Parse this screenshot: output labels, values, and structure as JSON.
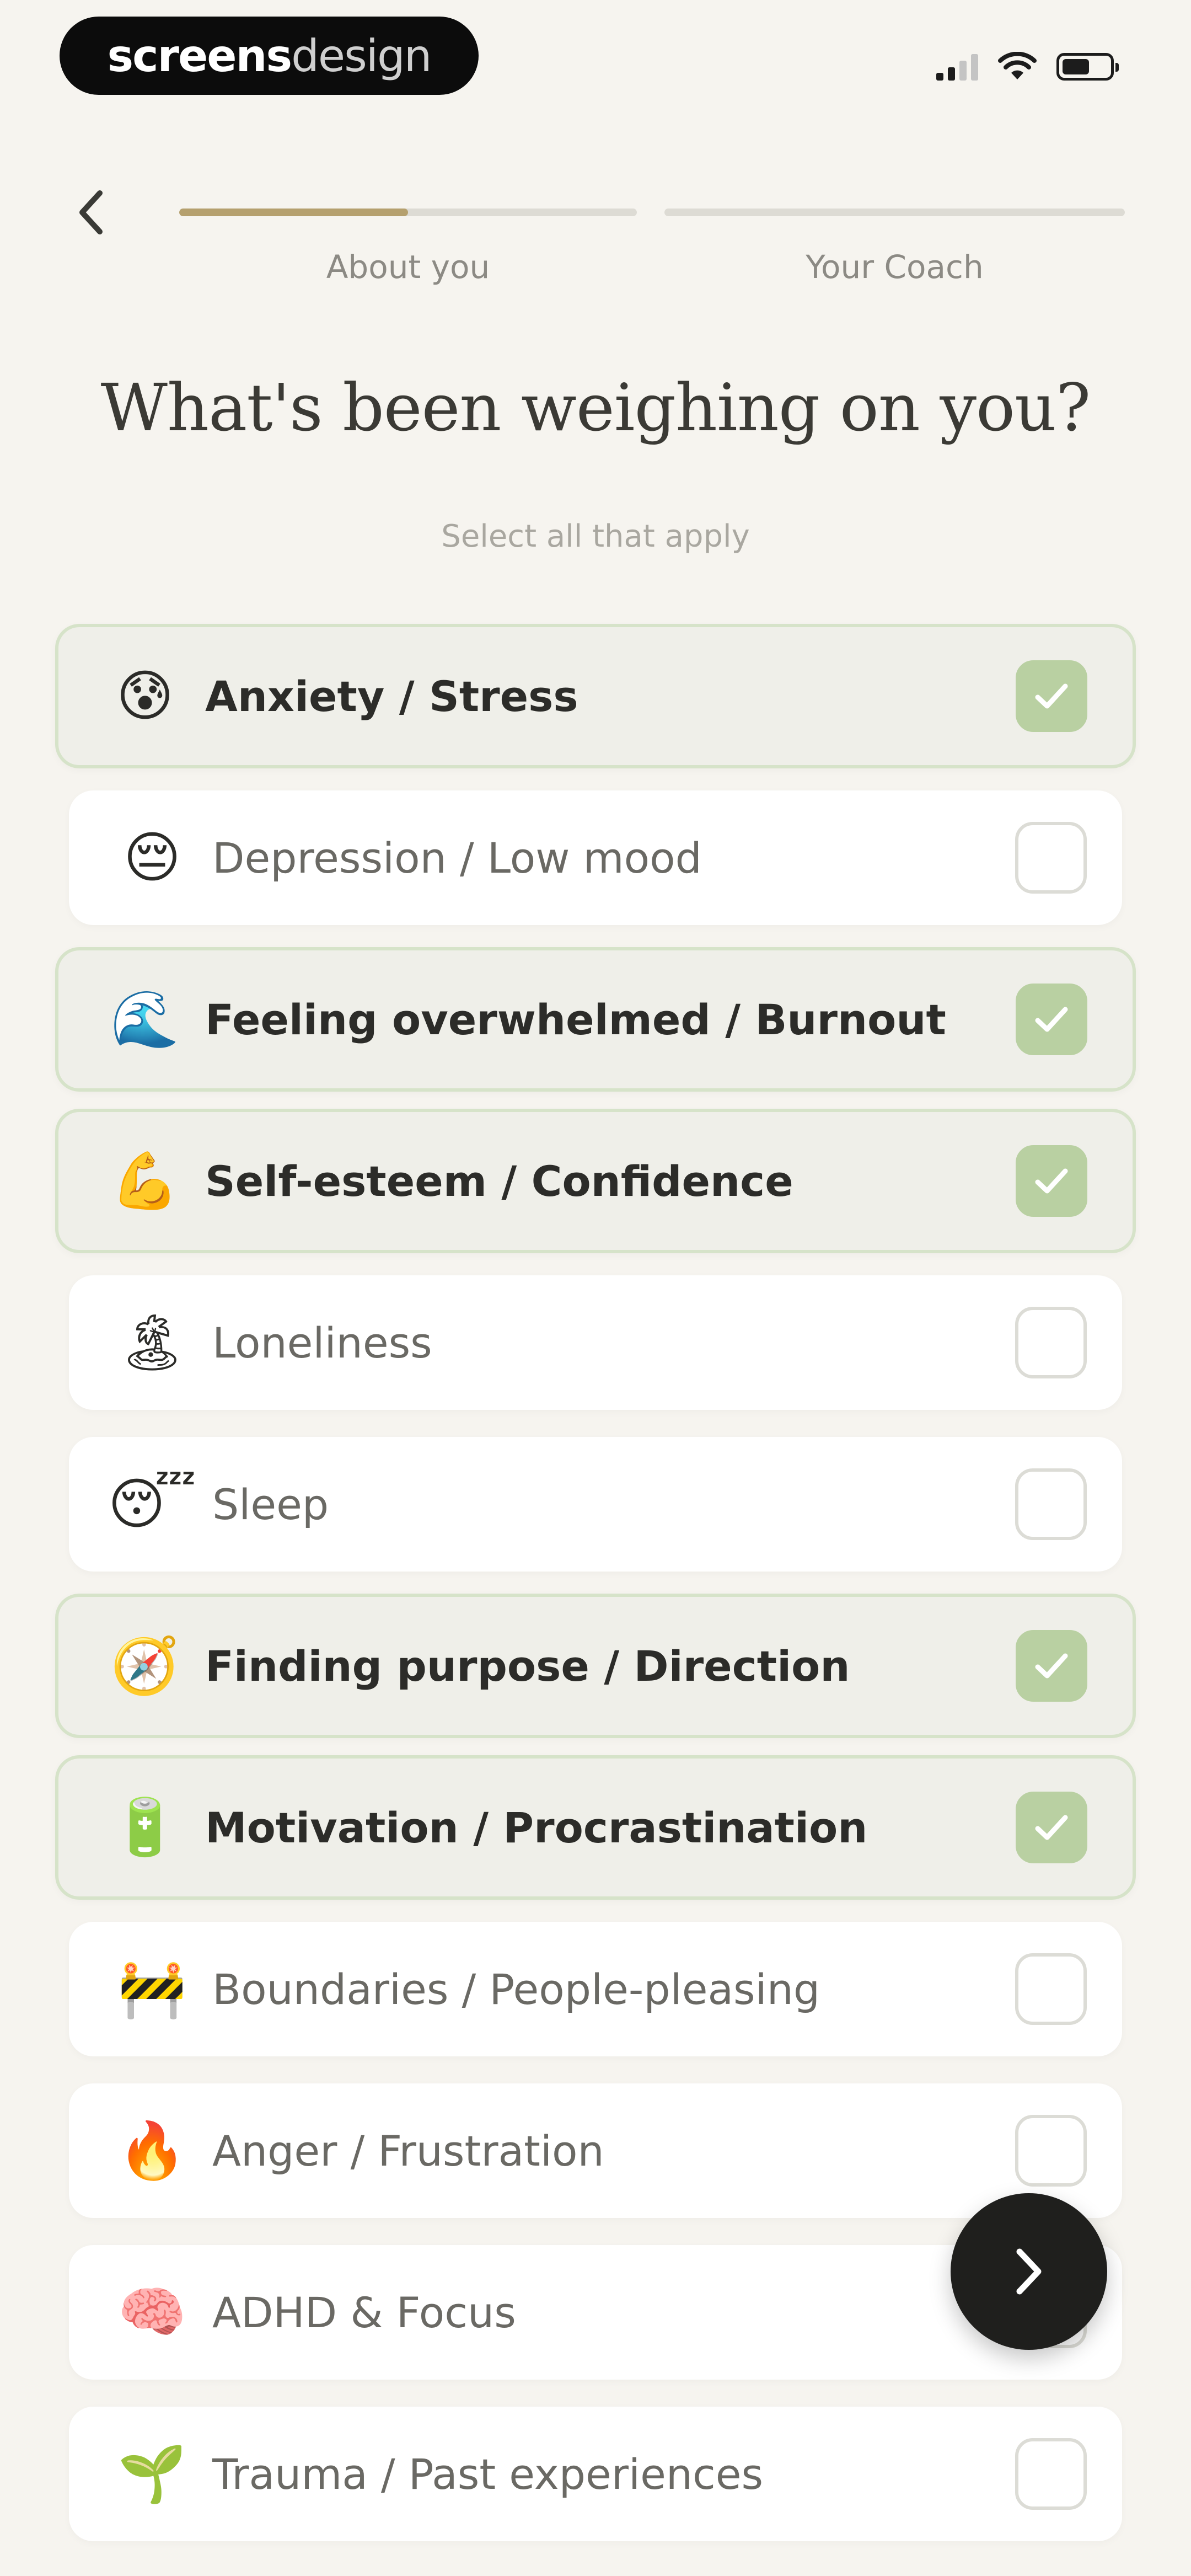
{
  "status_bar": {
    "brand_bold": "screens",
    "brand_light": "design",
    "icons": [
      "cellular-signal-icon",
      "wifi-icon",
      "battery-icon"
    ]
  },
  "nav": {
    "back_icon": "chevron-left-icon",
    "steps": [
      {
        "label": "About you",
        "progress": 0.5
      },
      {
        "label": "Your Coach",
        "progress": 0
      }
    ]
  },
  "header": {
    "title": "What's been weighing on you?",
    "subtitle": "Select all that apply"
  },
  "options": [
    {
      "emoji": "😰",
      "label": "Anxiety / Stress",
      "selected": true
    },
    {
      "emoji": "😔",
      "label": "Depression / Low mood",
      "selected": false
    },
    {
      "emoji": "🌊",
      "label": "Feeling overwhelmed / Burnout",
      "selected": true
    },
    {
      "emoji": "💪",
      "label": "Self-esteem / Confidence",
      "selected": true
    },
    {
      "emoji": "🏝",
      "label": "Loneliness",
      "selected": false
    },
    {
      "emoji": "😴",
      "label": "Sleep",
      "selected": false
    },
    {
      "emoji": "🧭",
      "label": "Finding purpose / Direction",
      "selected": true
    },
    {
      "emoji": "🔋",
      "label": "Motivation / Procrastination",
      "selected": true
    },
    {
      "emoji": "🚧",
      "label": "Boundaries / People-pleasing",
      "selected": false
    },
    {
      "emoji": "🔥",
      "label": "Anger / Frustration",
      "selected": false
    },
    {
      "emoji": "🧠",
      "label": "ADHD & Focus",
      "selected": false
    },
    {
      "emoji": "🌱",
      "label": "Trauma / Past experiences",
      "selected": false
    }
  ],
  "next_button": {
    "icon": "chevron-right-icon"
  },
  "colors": {
    "background": "#f6f4ef",
    "progress_fill": "#b5a06e",
    "progress_track": "#dddbd4",
    "selected_card": "#efefe9",
    "selected_border": "#d6e3c9",
    "checkbox_checked": "#b9d0a2",
    "fab": "#1f1f1d"
  }
}
